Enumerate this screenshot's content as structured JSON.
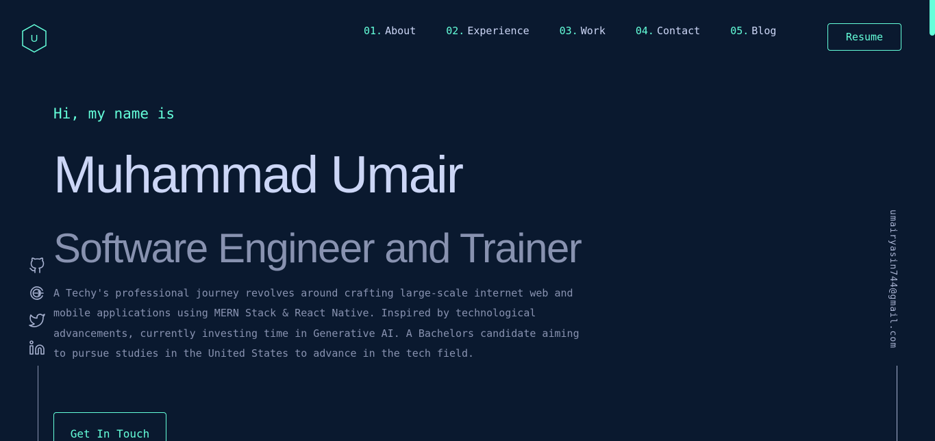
{
  "logo": {
    "letter": "U"
  },
  "nav": {
    "items": [
      {
        "num": "01.",
        "label": "About"
      },
      {
        "num": "02.",
        "label": "Experience"
      },
      {
        "num": "03.",
        "label": "Work"
      },
      {
        "num": "04.",
        "label": "Contact"
      },
      {
        "num": "05.",
        "label": "Blog"
      }
    ],
    "resume_label": "Resume"
  },
  "hero": {
    "greeting": "Hi, my name is",
    "name": "Muhammad Umair",
    "role": "Software Engineer and Trainer",
    "bio": "A Techy's professional journey revolves around crafting large-scale internet web and mobile applications using MERN Stack & React Native. Inspired by technological advancements, currently investing time in Generative AI. A Bachelors candidate aiming to pursue studies in the United States to advance in the tech field.",
    "cta_label": "Get In Touch"
  },
  "social": {
    "icons": [
      "github-icon",
      "codepen-icon",
      "twitter-icon",
      "linkedin-icon"
    ]
  },
  "email": "umairyasin744@gmail.com",
  "colors": {
    "background": "#0a192f",
    "accent": "#64ffda",
    "heading": "#ccd6f6",
    "muted": "#8892b0"
  }
}
